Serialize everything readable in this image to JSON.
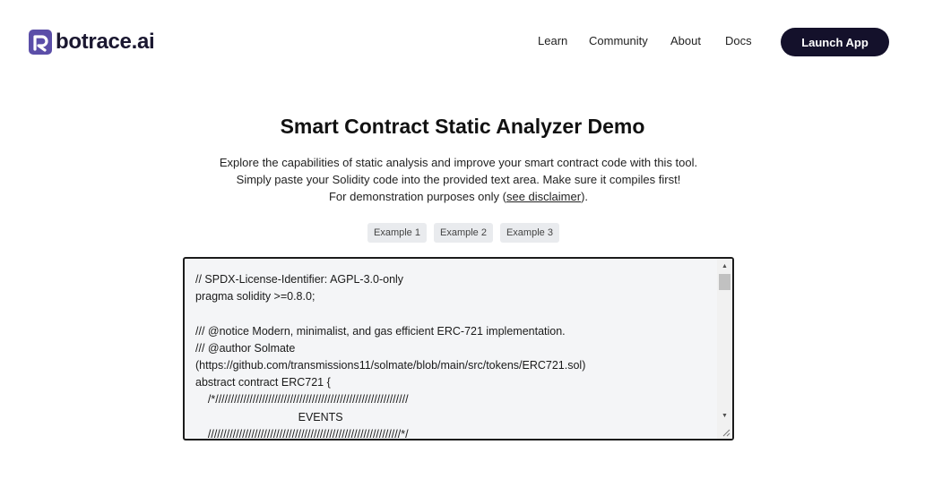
{
  "header": {
    "logo_text": "botrace.ai",
    "logo_icon": "botrace-logo-icon",
    "brand_color": "#5b4ea8",
    "nav": {
      "learn": "Learn",
      "community": "Community",
      "about": "About",
      "docs": "Docs"
    },
    "launch_label": "Launch App",
    "launch_color": "#14112b"
  },
  "main": {
    "title": "Smart Contract Static Analyzer Demo",
    "description": {
      "line1": "Explore the capabilities of static analysis and improve your smart contract code with this tool.",
      "line2": "Simply paste your Solidity code into the provided text area. Make sure it compiles first!",
      "line3_prefix": "For demonstration purposes only (",
      "line3_link": "see disclaimer",
      "line3_suffix": ")."
    },
    "examples": {
      "ex1": "Example 1",
      "ex2": "Example 2",
      "ex3": "Example 3"
    },
    "editor": {
      "code": "// SPDX-License-Identifier: AGPL-3.0-only\npragma solidity >=0.8.0;\n\n/// @notice Modern, minimalist, and gas efficient ERC-721 implementation.\n/// @author Solmate\n(https://github.com/transmissions11/solmate/blob/main/src/tokens/ERC721.sol)\nabstract contract ERC721 {\n    /*//////////////////////////////////////////////////////////////\n                                 EVENTS\n    //////////////////////////////////////////////////////////////*/"
    }
  }
}
